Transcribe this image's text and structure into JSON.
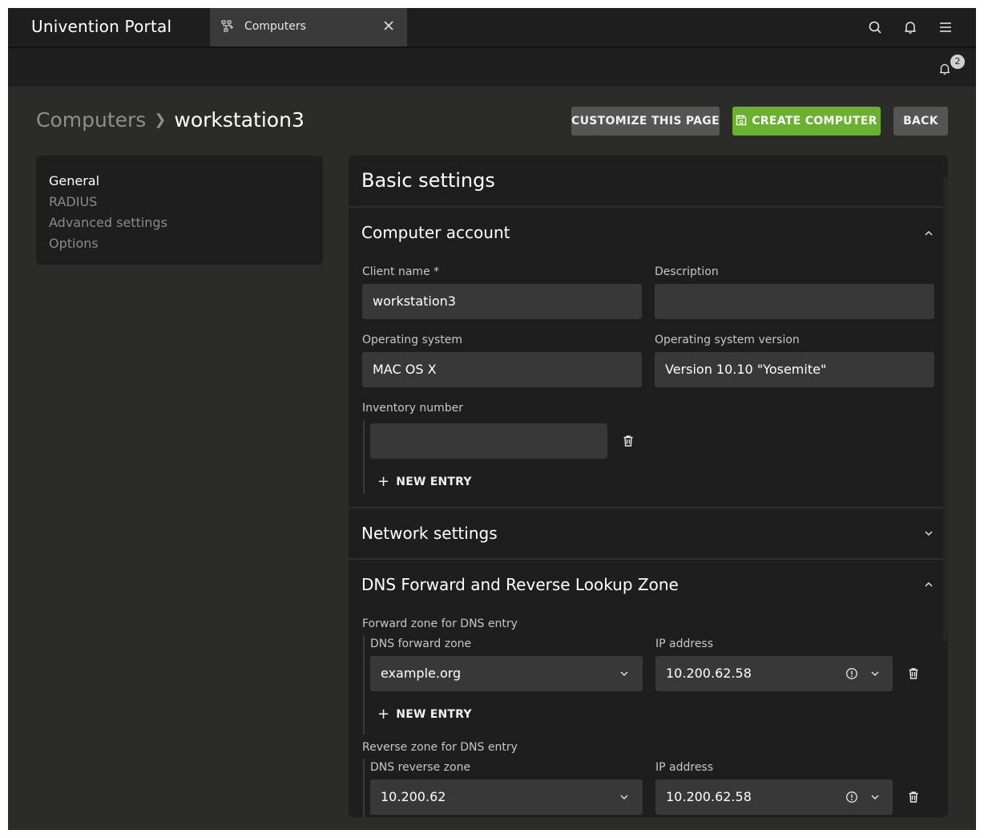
{
  "app": {
    "title": "Univention Portal"
  },
  "tab": {
    "label": "Computers"
  },
  "notifications": {
    "count": "2"
  },
  "breadcrumb": {
    "parent": "Computers",
    "current": "workstation3"
  },
  "actions": {
    "customize": "CUSTOMIZE THIS PAGE",
    "create": "CREATE COMPUTER",
    "back": "BACK"
  },
  "sidebar": {
    "items": [
      {
        "label": "General"
      },
      {
        "label": "RADIUS"
      },
      {
        "label": "Advanced settings"
      },
      {
        "label": "Options"
      }
    ]
  },
  "basic": {
    "title": "Basic settings"
  },
  "account": {
    "title": "Computer account",
    "client_name_label": "Client name *",
    "client_name": "workstation3",
    "description_label": "Description",
    "description": "",
    "os_label": "Operating system",
    "os": "MAC OS X",
    "os_version_label": "Operating system version",
    "os_version": "Version 10.10 \"Yosemite\"",
    "inventory_label": "Inventory number",
    "inventory": "",
    "new_entry": "NEW ENTRY"
  },
  "network": {
    "title": "Network settings"
  },
  "dns": {
    "title": "DNS Forward and Reverse Lookup Zone",
    "forward_group_label": "Forward zone for DNS entry",
    "forward_zone_label": "DNS forward zone",
    "forward_zone": "example.org",
    "forward_ip_label": "IP address",
    "forward_ip": "10.200.62.58",
    "new_entry": "NEW ENTRY",
    "reverse_group_label": "Reverse zone for DNS entry",
    "reverse_zone_label": "DNS reverse zone",
    "reverse_zone": "10.200.62",
    "reverse_ip_label": "IP address",
    "reverse_ip": "10.200.62.58"
  }
}
